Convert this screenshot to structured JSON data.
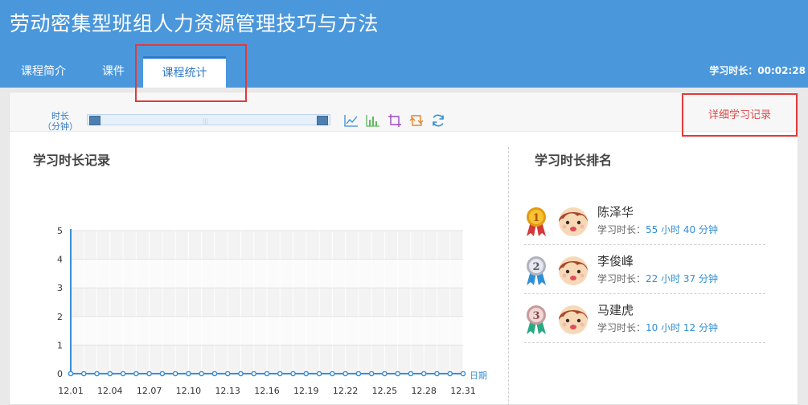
{
  "header": {
    "course_title": "劳动密集型班组人力资源管理技巧与方法",
    "tabs": [
      {
        "label": "课程简介"
      },
      {
        "label": "课件"
      },
      {
        "label": "课程统计"
      }
    ],
    "study_time_label": "学习时长：",
    "study_time_value": "00:02:28"
  },
  "panel": {
    "detail_link": "详细学习记录",
    "left_title": "学习时长记录",
    "right_title": "学习时长排名"
  },
  "chart_data": {
    "type": "line",
    "ylabel": "时长\n（分钟）",
    "xlabel": "日期",
    "ylim": [
      0,
      5
    ],
    "y_ticks": [
      0,
      1,
      2,
      3,
      4,
      5
    ],
    "x_tick_labels": [
      "12.01",
      "12.04",
      "12.07",
      "12.10",
      "12.13",
      "12.16",
      "12.19",
      "12.22",
      "12.25",
      "12.28",
      "12.31"
    ],
    "x": [
      "12.01",
      "12.02",
      "12.03",
      "12.04",
      "12.05",
      "12.06",
      "12.07",
      "12.08",
      "12.09",
      "12.10",
      "12.11",
      "12.12",
      "12.13",
      "12.14",
      "12.15",
      "12.16",
      "12.17",
      "12.18",
      "12.19",
      "12.20",
      "12.21",
      "12.22",
      "12.23",
      "12.24",
      "12.25",
      "12.26",
      "12.27",
      "12.28",
      "12.29",
      "12.30",
      "12.31"
    ],
    "series": [
      {
        "values": [
          0,
          0,
          0,
          0,
          0,
          0,
          0,
          0,
          0,
          0,
          0,
          0,
          0,
          0,
          0,
          0,
          0,
          0,
          0,
          0,
          0,
          0,
          0,
          0,
          0,
          0,
          0,
          0,
          0,
          0,
          0
        ]
      }
    ],
    "grid": true,
    "color": "#3a8ed6"
  },
  "toolbox": [
    {
      "icon": "line-chart-icon",
      "color": "#3a8ed6"
    },
    {
      "icon": "bar-chart-icon",
      "color": "#5cb85c"
    },
    {
      "icon": "zoom-select-icon",
      "color": "#9b4bbf"
    },
    {
      "icon": "zoom-reset-icon",
      "color": "#e6852f"
    },
    {
      "icon": "refresh-icon",
      "color": "#2f8fd8"
    }
  ],
  "ranking": [
    {
      "rank": "1",
      "name": "陈泽华",
      "label": "学习时长：",
      "value": "55 小时 40 分钟"
    },
    {
      "rank": "2",
      "name": "李俊峰",
      "label": "学习时长：",
      "value": "22 小时 37 分钟"
    },
    {
      "rank": "3",
      "name": "马建虎",
      "label": "学习时长：",
      "value": "10 小时 12 分钟"
    }
  ]
}
